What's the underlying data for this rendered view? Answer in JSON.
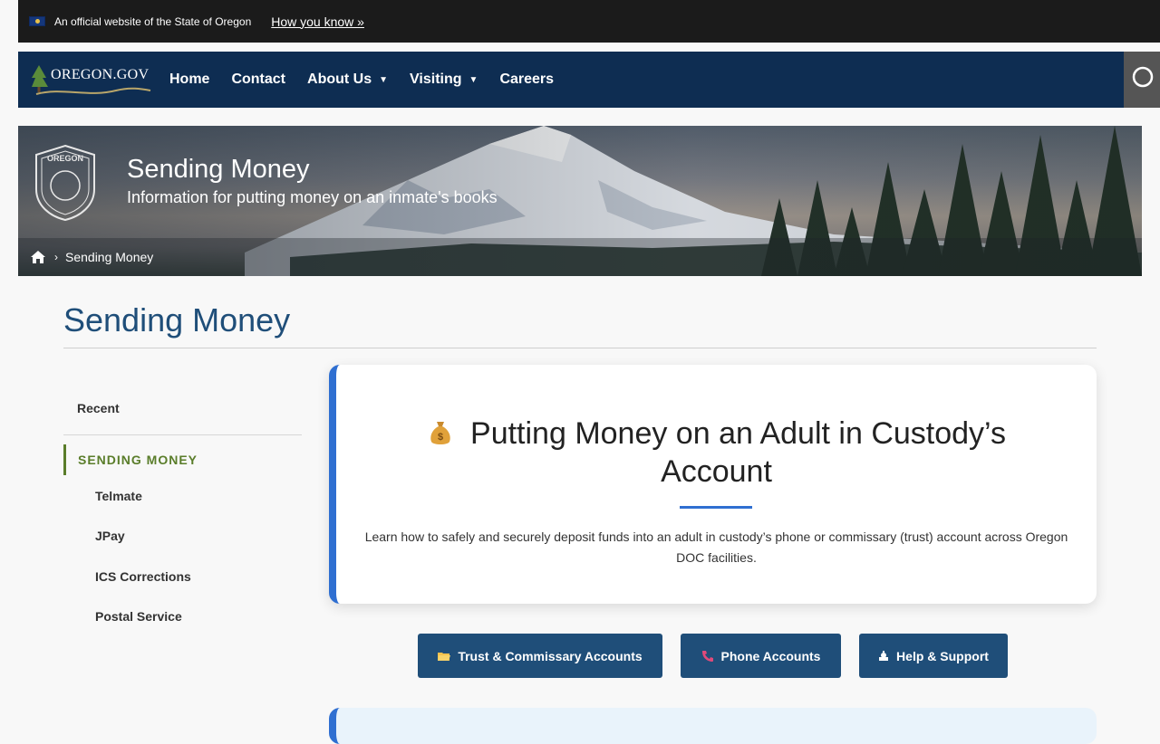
{
  "official": {
    "text": "An official website of the State of Oregon",
    "link": "How you know »"
  },
  "nav": {
    "logo": "OREGON.GOV",
    "items": [
      {
        "label": "Home"
      },
      {
        "label": "Contact"
      },
      {
        "label": "About Us",
        "caret": "▼"
      },
      {
        "label": "Visiting",
        "caret": "▼"
      },
      {
        "label": "Careers"
      }
    ],
    "search_icon": "search-icon"
  },
  "hero": {
    "title": "Sending Money",
    "subtitle": "Information for putting money on an inmate's books",
    "seal_text_top": "OREGON",
    "breadcrumb": {
      "home_icon": "home-icon",
      "current": "Sending Money"
    }
  },
  "page": {
    "title": "Sending Money"
  },
  "sidebar": {
    "recent": "Recent",
    "active": "SENDING MONEY",
    "items": [
      "Telmate",
      "JPay",
      "ICS Corrections",
      "Postal Service"
    ]
  },
  "card": {
    "icon": "money-bag-icon",
    "title": "Putting Money on an Adult in Custody’s Account",
    "description": "Learn how to safely and securely deposit funds into an adult in custody’s phone or commissary (trust) account across Oregon DOC facilities."
  },
  "buttons": [
    {
      "label": "Trust & Commissary Accounts",
      "icon": "folder-icon"
    },
    {
      "label": "Phone Accounts",
      "icon": "phone-icon"
    },
    {
      "label": "Help & Support",
      "icon": "support-icon"
    }
  ],
  "colors": {
    "navy": "#0e2d52",
    "accent_blue": "#2f6fd1",
    "button_blue": "#1f4e79",
    "green": "#5a7d2a"
  }
}
